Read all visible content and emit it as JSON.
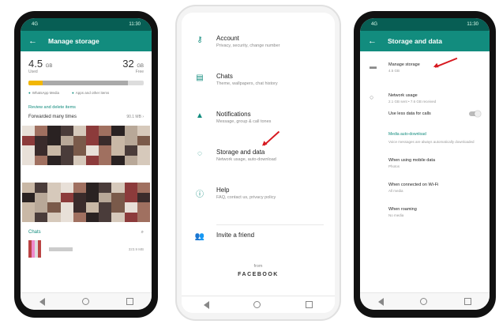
{
  "phone1": {
    "status_left": "4G",
    "status_right": "11:30",
    "title": "Manage storage",
    "used": "4.5",
    "used_unit": "GB",
    "used_sub": "Used",
    "free": "32",
    "free_unit": "GB",
    "free_sub": "Free",
    "used_fraction": 0.12,
    "other_fraction": 0.86,
    "legend_a": "WhatsApp Media",
    "legend_b": "Apps and other items",
    "review_link": "Review and delete items",
    "forwarded_label": "Forwarded many times",
    "forwarded_size": "90.1 MB",
    "chats_label": "Chats",
    "chat_size": "323.9 MB"
  },
  "phone2": {
    "items": [
      {
        "icon": "key-icon",
        "title": "Account",
        "subtitle": "Privacy, security, change number"
      },
      {
        "icon": "chat-icon",
        "title": "Chats",
        "subtitle": "Theme, wallpapers, chat history"
      },
      {
        "icon": "bell-icon",
        "title": "Notifications",
        "subtitle": "Message, group & call tones"
      },
      {
        "icon": "data-icon",
        "title": "Storage and data",
        "subtitle": "Network usage, auto-download"
      },
      {
        "icon": "help-icon",
        "title": "Help",
        "subtitle": "FAQ, contact us, privacy policy"
      },
      {
        "icon": "people-icon",
        "title": "Invite a friend",
        "subtitle": ""
      }
    ],
    "from": "from",
    "facebook": "FACEBOOK"
  },
  "phone3": {
    "status_left": "4G",
    "status_right": "11:30",
    "title": "Storage and data",
    "manage_title": "Manage storage",
    "manage_sub": "4.5 GB",
    "network_title": "Network usage",
    "network_sub": "2.1 GB sent • 7.6 GB received",
    "lessdata_title": "Use less data for calls",
    "media_hdr": "Media auto-download",
    "media_note": "Voice messages are always automatically downloaded",
    "mobile_title": "When using mobile data",
    "mobile_sub": "Photos",
    "wifi_title": "When connected on Wi-Fi",
    "wifi_sub": "All media",
    "roaming_title": "When roaming",
    "roaming_sub": "No media"
  },
  "colors": {
    "teal_dark": "#075e54",
    "teal": "#128c7e",
    "arrow_red": "#d71920",
    "storage_yellow": "#f2b705"
  }
}
